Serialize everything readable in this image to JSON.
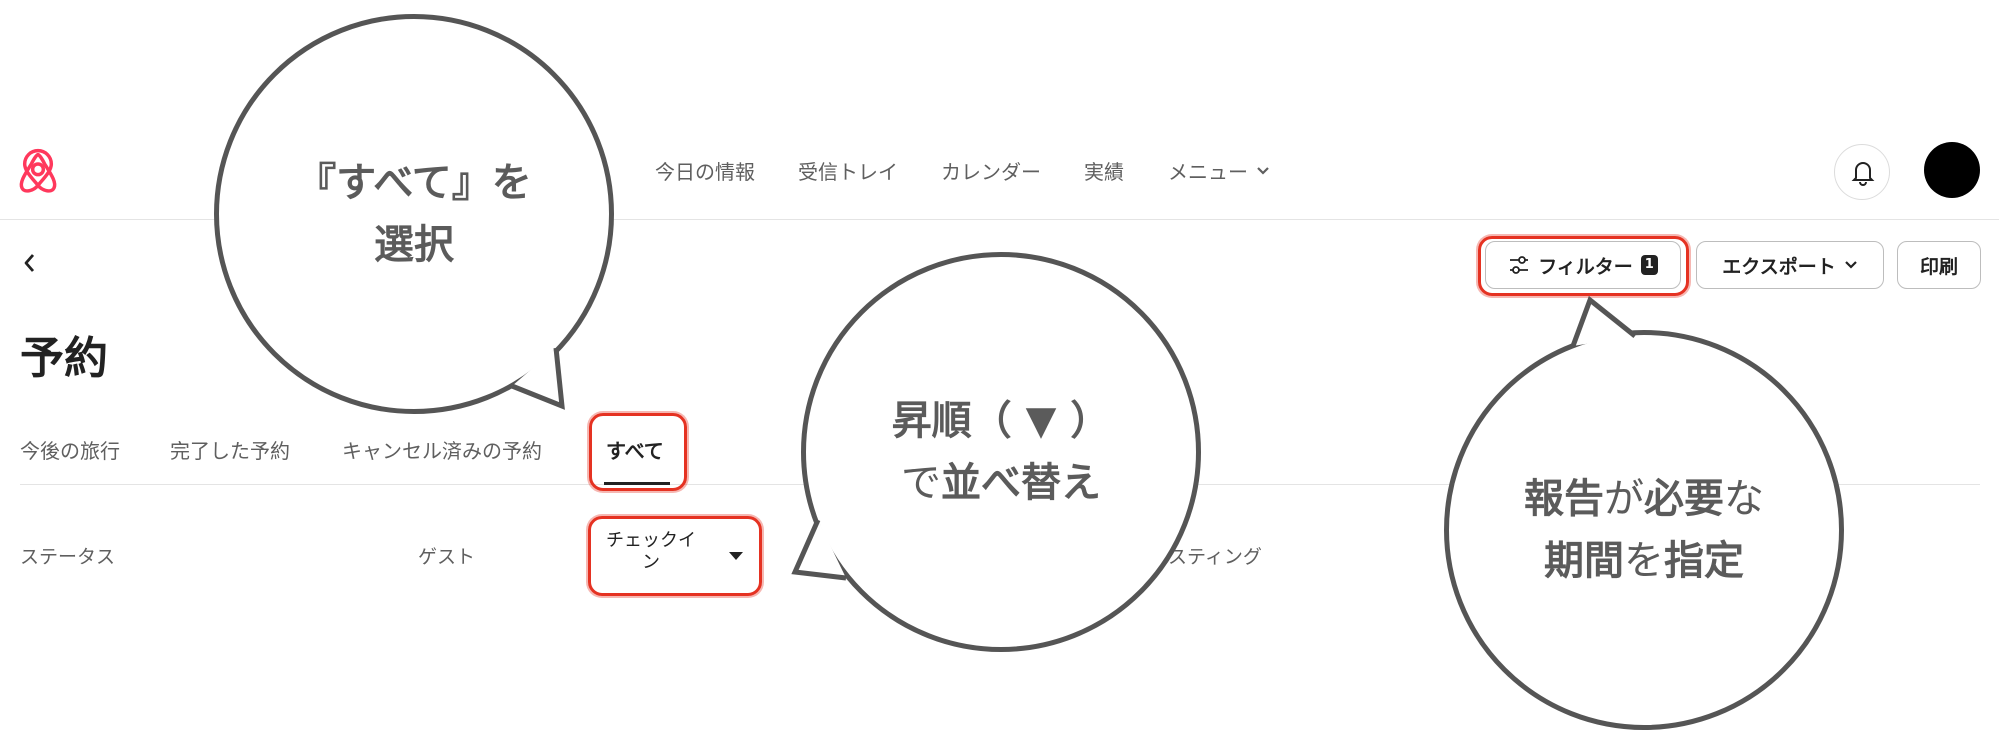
{
  "nav": {
    "items": [
      {
        "label": "今日の情報"
      },
      {
        "label": "受信トレイ"
      },
      {
        "label": "カレンダー"
      },
      {
        "label": "実績"
      },
      {
        "label": "メニュー"
      }
    ]
  },
  "toolbar": {
    "filter_label": "フィルター",
    "filter_count": "1",
    "export_label": "エクスポート",
    "print_label": "印刷"
  },
  "page": {
    "title": "予約"
  },
  "tabs": [
    {
      "label": "今後の旅行"
    },
    {
      "label": "完了した予約"
    },
    {
      "label": "キャンセル済みの予約"
    },
    {
      "label": "すべて",
      "active": true
    }
  ],
  "table": {
    "columns": [
      {
        "label": "ステータス"
      },
      {
        "label": "ゲスト"
      },
      {
        "label_line1": "チェックイ",
        "label_line2": "ン"
      },
      {
        "label": "スティング"
      }
    ]
  },
  "annotations": {
    "bubble1": {
      "line1": "『すべて』を",
      "line2": "選択"
    },
    "bubble2": {
      "line1": "昇順（ ▼ ）",
      "line2_a": "で",
      "line2_b": "並べ替え"
    },
    "bubble3": {
      "line1_a": "報告",
      "line1_b": "が",
      "line1_c": "必要",
      "line1_d": "な",
      "line2_a": "期間",
      "line2_b": "を",
      "line2_c": "指定"
    }
  },
  "colors": {
    "accent": "#ff385c",
    "highlight": "#e53222",
    "bubble_border": "#555555"
  },
  "icons": [
    "airbnb-logo",
    "bell-icon",
    "back-chevron-icon",
    "sliders-icon",
    "chevron-down-icon",
    "caret-down-icon"
  ]
}
